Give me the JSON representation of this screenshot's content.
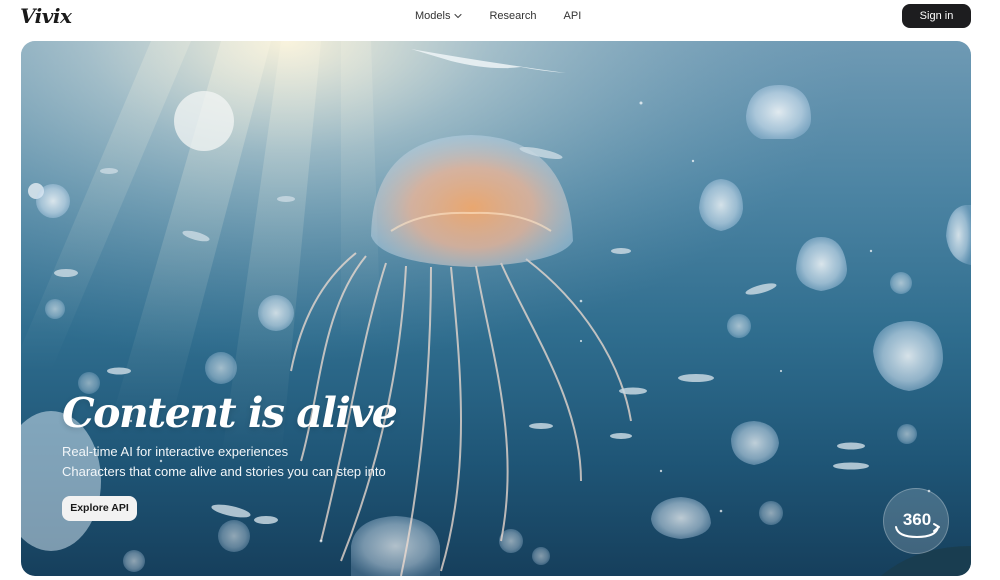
{
  "brand": {
    "logo_text": "Vivix"
  },
  "nav": {
    "items": [
      {
        "label": "Models",
        "has_dropdown": true
      },
      {
        "label": "Research"
      },
      {
        "label": "API"
      }
    ],
    "signin_label": "Sign in"
  },
  "hero": {
    "headline": "Content is alive",
    "subline_1": "Real-time AI for interactive experiences",
    "subline_2": "Characters that come alive and stories you can step into",
    "cta_label": "Explore API",
    "badge_label": "360"
  },
  "colors": {
    "signin_bg": "#1d1d1f",
    "cta_bg": "#f2f2f2",
    "ocean_top": "#6f9ab4",
    "ocean_bottom": "#163f5c"
  }
}
